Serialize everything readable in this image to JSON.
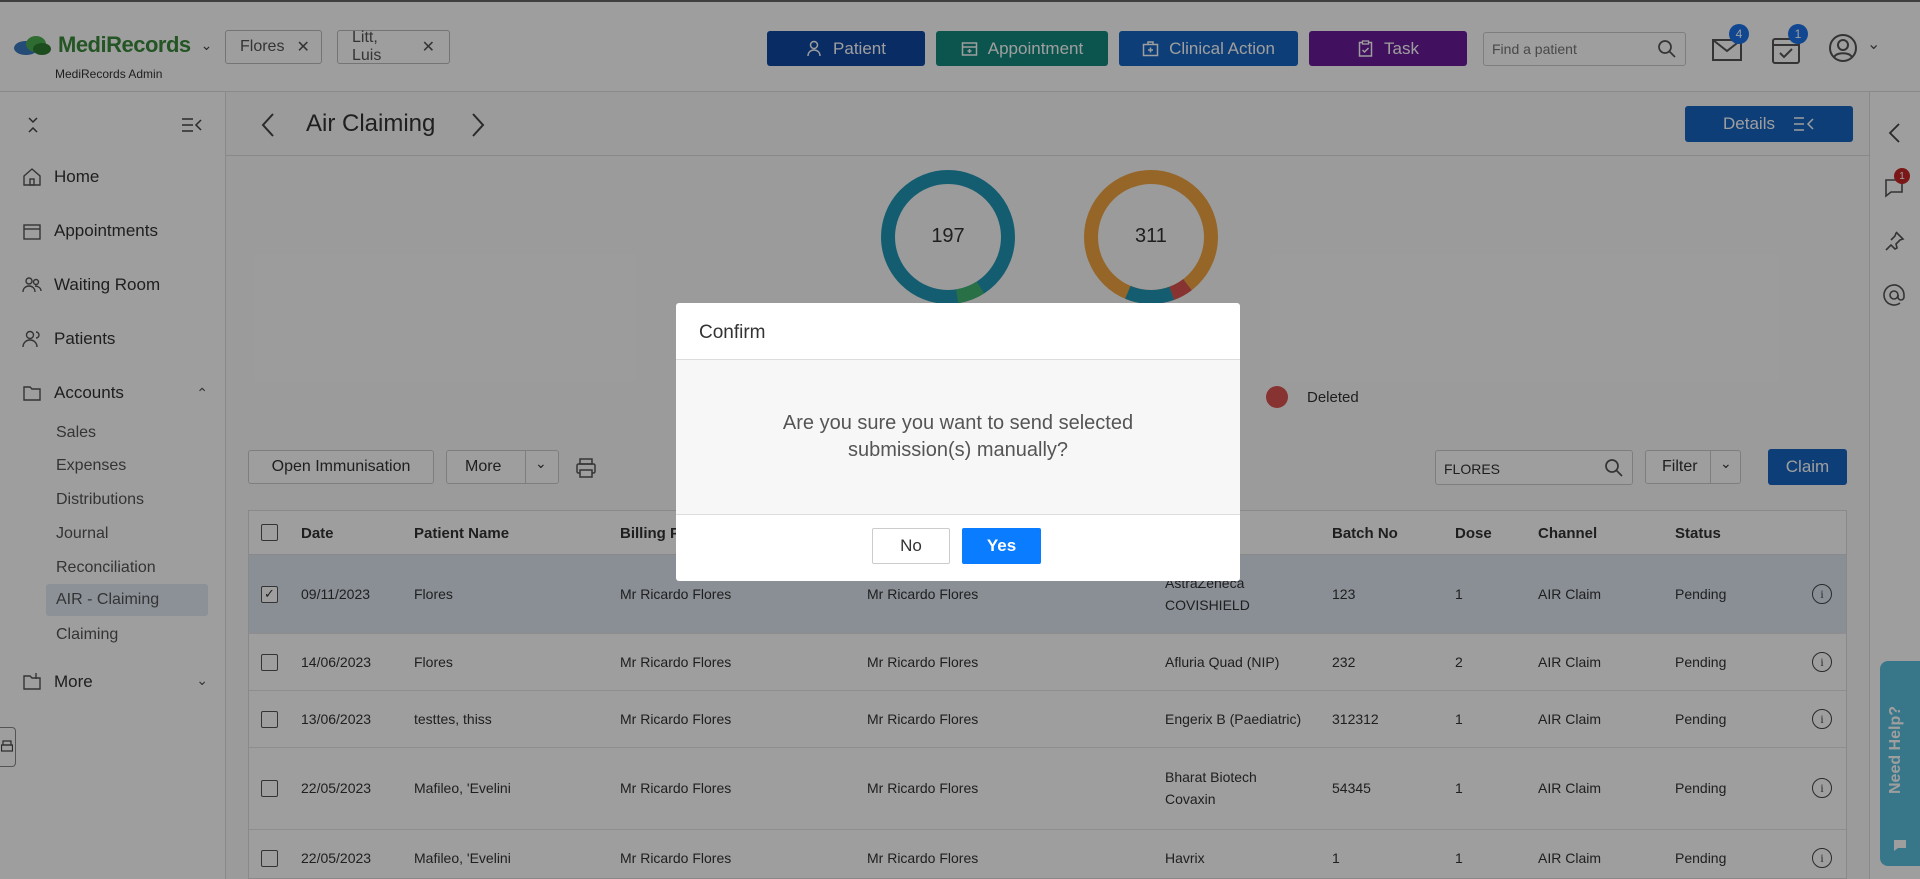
{
  "app": {
    "brand": "MediRecords",
    "brand_sub": "MediRecords Admin"
  },
  "patient_tabs": [
    {
      "label": "Flores"
    },
    {
      "label": "Litt, Luis"
    }
  ],
  "quick_actions": {
    "patient": "Patient",
    "appointment": "Appointment",
    "clinical_action": "Clinical Action",
    "task": "Task"
  },
  "colors": {
    "patient": "#0d47a1",
    "appointment": "#138a7e",
    "clinical_action": "#1565c0",
    "task": "#6a1b9a",
    "primary": "#1565c0",
    "donut_teal": "#2196b6",
    "donut_orange": "#f0a541",
    "deleted": "#d9534f"
  },
  "search_top": {
    "placeholder": "Find a patient"
  },
  "badges": {
    "mail": "4",
    "tasks": "1",
    "chat": "1"
  },
  "sidebar": {
    "items": {
      "home": "Home",
      "appointments": "Appointments",
      "waiting_room": "Waiting Room",
      "patients": "Patients",
      "accounts": "Accounts",
      "more": "More"
    },
    "accounts_sub": [
      "Sales",
      "Expenses",
      "Distributions",
      "Journal",
      "Reconciliation",
      "AIR - Claiming",
      "Claiming"
    ]
  },
  "page": {
    "title": "Air Claiming",
    "details_label": "Details"
  },
  "summary": {
    "donut1_value": "197",
    "donut2_value": "311",
    "legend_deleted": "Deleted"
  },
  "toolbar": {
    "open_immunisation": "Open Immunisation",
    "more": "More",
    "search_value": "FLORES",
    "filter": "Filter",
    "claim": "Claim"
  },
  "table": {
    "headers": [
      "Date",
      "Patient Name",
      "Billing Pr",
      "Batch No",
      "Dose",
      "Channel",
      "Status"
    ],
    "rows": [
      {
        "date": "09/11/2023",
        "patient": "Flores",
        "billing": "Mr Ricardo Flores",
        "provider": "Mr Ricardo Flores",
        "vaccine": "AstraZeneca COVISHIELD",
        "batch": "123",
        "dose": "1",
        "channel": "AIR Claim",
        "status": "Pending",
        "checked": true
      },
      {
        "date": "14/06/2023",
        "patient": "Flores",
        "billing": "Mr Ricardo Flores",
        "provider": "Mr Ricardo Flores",
        "vaccine": "Afluria Quad (NIP)",
        "batch": "232",
        "dose": "2",
        "channel": "AIR Claim",
        "status": "Pending",
        "checked": false
      },
      {
        "date": "13/06/2023",
        "patient": "testtes, thiss",
        "billing": "Mr Ricardo Flores",
        "provider": "Mr Ricardo Flores",
        "vaccine": "Engerix B (Paediatric)",
        "batch": "312312",
        "dose": "1",
        "channel": "AIR Claim",
        "status": "Pending",
        "checked": false
      },
      {
        "date": "22/05/2023",
        "patient": "Mafileo, 'Evelini",
        "billing": "Mr Ricardo Flores",
        "provider": "Mr Ricardo Flores",
        "vaccine": "Bharat Biotech Covaxin",
        "batch": "54345",
        "dose": "1",
        "channel": "AIR Claim",
        "status": "Pending",
        "checked": false
      },
      {
        "date": "22/05/2023",
        "patient": "Mafileo, 'Evelini",
        "billing": "Mr Ricardo Flores",
        "provider": "Mr Ricardo Flores",
        "vaccine": "Havrix",
        "batch": "1",
        "dose": "1",
        "channel": "AIR Claim",
        "status": "Pending",
        "checked": false
      }
    ]
  },
  "help": {
    "label": "Need Help?"
  },
  "modal": {
    "title": "Confirm",
    "message": "Are you sure you want to send selected submission(s) manually?",
    "no": "No",
    "yes": "Yes"
  }
}
